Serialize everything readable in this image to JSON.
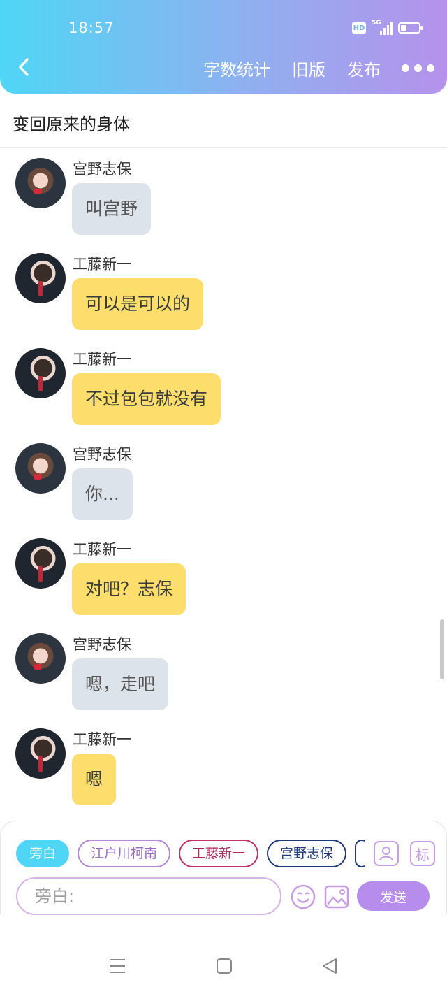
{
  "status_bar": {
    "time": "18:57",
    "network": "5G",
    "hd": "HD"
  },
  "header": {
    "actions": [
      "字数统计",
      "旧版",
      "发布"
    ]
  },
  "document": {
    "title": "变回原来的身体"
  },
  "messages": [
    {
      "speaker": "宫野志保",
      "text": "叫宫野",
      "side": "shiho"
    },
    {
      "speaker": "工藤新一",
      "text": "可以是可以的",
      "side": "shinichi"
    },
    {
      "speaker": "工藤新一",
      "text": "不过包包就没有",
      "side": "shinichi"
    },
    {
      "speaker": "宫野志保",
      "text": "你...",
      "side": "shiho"
    },
    {
      "speaker": "工藤新一",
      "text": "对吧？志保",
      "side": "shinichi"
    },
    {
      "speaker": "宫野志保",
      "text": "嗯，走吧",
      "side": "shiho"
    },
    {
      "speaker": "工藤新一",
      "text": "嗯",
      "side": "shinichi"
    }
  ],
  "composer": {
    "roles": [
      "旁白",
      "江户川柯南",
      "工藤新一",
      "宫野志保"
    ],
    "active_role": "旁白",
    "mark_tool_label": "标",
    "input_placeholder": "旁白:",
    "send_label": "发送"
  },
  "colors": {
    "header_gradient_start": "#4fd6f6",
    "header_gradient_end": "#b592ec",
    "bubble_shiho": "#dde3ea",
    "bubble_shinichi": "#fddd6b",
    "send_button": "#b68cec"
  },
  "icons": [
    "back-arrow-icon",
    "more-icon",
    "role-icon",
    "emoji-icon",
    "image-icon",
    "menu-icon",
    "home-icon",
    "back-icon"
  ]
}
